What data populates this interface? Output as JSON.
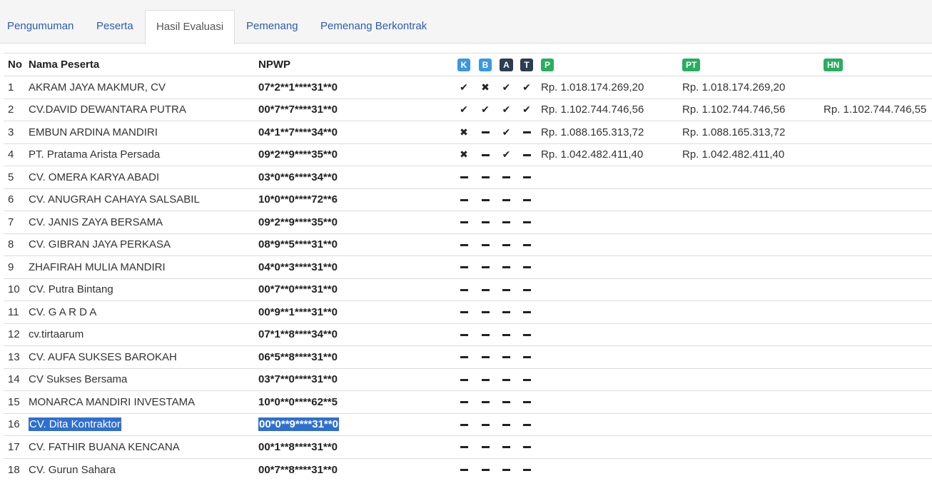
{
  "tabs": [
    {
      "label": "Pengumuman",
      "active": false
    },
    {
      "label": "Peserta",
      "active": false
    },
    {
      "label": "Hasil Evaluasi",
      "active": true
    },
    {
      "label": "Pemenang",
      "active": false
    },
    {
      "label": "Pemenang Berkontrak",
      "active": false
    }
  ],
  "columns": {
    "no": "No",
    "name": "Nama Peserta",
    "npwp": "NPWP",
    "badges": [
      {
        "label": "K",
        "color": "#3b97e3"
      },
      {
        "label": "B",
        "color": "#3b97e3"
      },
      {
        "label": "A",
        "color": "#2c3e50"
      },
      {
        "label": "T",
        "color": "#2c3e50"
      },
      {
        "label": "P",
        "color": "#27ae60"
      }
    ],
    "pt": {
      "label": "PT",
      "color": "#27ae60"
    },
    "hn": {
      "label": "HN",
      "color": "#27ae60"
    }
  },
  "rows": [
    {
      "no": "1",
      "name": "AKRAM JAYA MAKMUR, CV",
      "npwp": "07*2**1****31**0",
      "k": "check",
      "b": "cross",
      "a": "check",
      "t": "check",
      "p": "Rp. 1.018.174.269,20",
      "pt": "Rp. 1.018.174.269,20",
      "hn": ""
    },
    {
      "no": "2",
      "name": "CV.DAVID DEWANTARA PUTRA",
      "npwp": "00*7**7****31**0",
      "k": "check",
      "b": "check",
      "a": "check",
      "t": "check",
      "p": "Rp. 1.102.744.746,56",
      "pt": "Rp. 1.102.744.746,56",
      "hn": "Rp. 1.102.744.746,55"
    },
    {
      "no": "3",
      "name": "EMBUN ARDINA MANDIRI",
      "npwp": "04*1**7****34**0",
      "k": "cross",
      "b": "dash",
      "a": "check",
      "t": "dash",
      "p": "Rp. 1.088.165.313,72",
      "pt": "Rp. 1.088.165.313,72",
      "hn": ""
    },
    {
      "no": "4",
      "name": "PT. Pratama Arista Persada",
      "npwp": "09*2**9****35**0",
      "k": "cross",
      "b": "dash",
      "a": "check",
      "t": "dash",
      "p": "Rp. 1.042.482.411,40",
      "pt": "Rp. 1.042.482.411,40",
      "hn": ""
    },
    {
      "no": "5",
      "name": "CV. OMERA KARYA ABADI",
      "npwp": "03*0**6****34**0",
      "k": "dash",
      "b": "dash",
      "a": "dash",
      "t": "dash",
      "p": "",
      "pt": "",
      "hn": ""
    },
    {
      "no": "6",
      "name": "CV. ANUGRAH CAHAYA SALSABIL",
      "npwp": "10*0**0****72**6",
      "k": "dash",
      "b": "dash",
      "a": "dash",
      "t": "dash",
      "p": "",
      "pt": "",
      "hn": ""
    },
    {
      "no": "7",
      "name": "CV. JANIS ZAYA BERSAMA",
      "npwp": "09*2**9****35**0",
      "k": "dash",
      "b": "dash",
      "a": "dash",
      "t": "dash",
      "p": "",
      "pt": "",
      "hn": ""
    },
    {
      "no": "8",
      "name": "CV. GIBRAN JAYA PERKASA",
      "npwp": "08*9**5****31**0",
      "k": "dash",
      "b": "dash",
      "a": "dash",
      "t": "dash",
      "p": "",
      "pt": "",
      "hn": ""
    },
    {
      "no": "9",
      "name": "ZHAFIRAH MULIA MANDIRI",
      "npwp": "04*0**3****31**0",
      "k": "dash",
      "b": "dash",
      "a": "dash",
      "t": "dash",
      "p": "",
      "pt": "",
      "hn": ""
    },
    {
      "no": "10",
      "name": "CV. Putra Bintang",
      "npwp": "00*7**0****31**0",
      "k": "dash",
      "b": "dash",
      "a": "dash",
      "t": "dash",
      "p": "",
      "pt": "",
      "hn": ""
    },
    {
      "no": "11",
      "name": "CV. G A R D A",
      "npwp": "00*9**1****31**0",
      "k": "dash",
      "b": "dash",
      "a": "dash",
      "t": "dash",
      "p": "",
      "pt": "",
      "hn": ""
    },
    {
      "no": "12",
      "name": "cv.tirtaarum",
      "npwp": "07*1**8****34**0",
      "k": "dash",
      "b": "dash",
      "a": "dash",
      "t": "dash",
      "p": "",
      "pt": "",
      "hn": ""
    },
    {
      "no": "13",
      "name": "CV. AUFA SUKSES BAROKAH",
      "npwp": "06*5**8****31**0",
      "k": "dash",
      "b": "dash",
      "a": "dash",
      "t": "dash",
      "p": "",
      "pt": "",
      "hn": ""
    },
    {
      "no": "14",
      "name": "CV Sukses Bersama",
      "npwp": "03*7**0****31**0",
      "k": "dash",
      "b": "dash",
      "a": "dash",
      "t": "dash",
      "p": "",
      "pt": "",
      "hn": ""
    },
    {
      "no": "15",
      "name": "MONARCA MANDIRI INVESTAMA",
      "npwp": "10*0**0****62**5",
      "k": "dash",
      "b": "dash",
      "a": "dash",
      "t": "dash",
      "p": "",
      "pt": "",
      "hn": ""
    },
    {
      "no": "16",
      "name": "CV. Dita Kontraktor",
      "npwp": "00*0**9****31**0",
      "k": "dash",
      "b": "dash",
      "a": "dash",
      "t": "dash",
      "p": "",
      "pt": "",
      "hn": "",
      "selected": true
    },
    {
      "no": "17",
      "name": "CV. FATHIR BUANA KENCANA",
      "npwp": "00*1**8****31**0",
      "k": "dash",
      "b": "dash",
      "a": "dash",
      "t": "dash",
      "p": "",
      "pt": "",
      "hn": ""
    },
    {
      "no": "18",
      "name": "CV. Gurun Sahara",
      "npwp": "00*7**8****31**0",
      "k": "dash",
      "b": "dash",
      "a": "dash",
      "t": "dash",
      "p": "",
      "pt": "",
      "hn": ""
    }
  ]
}
